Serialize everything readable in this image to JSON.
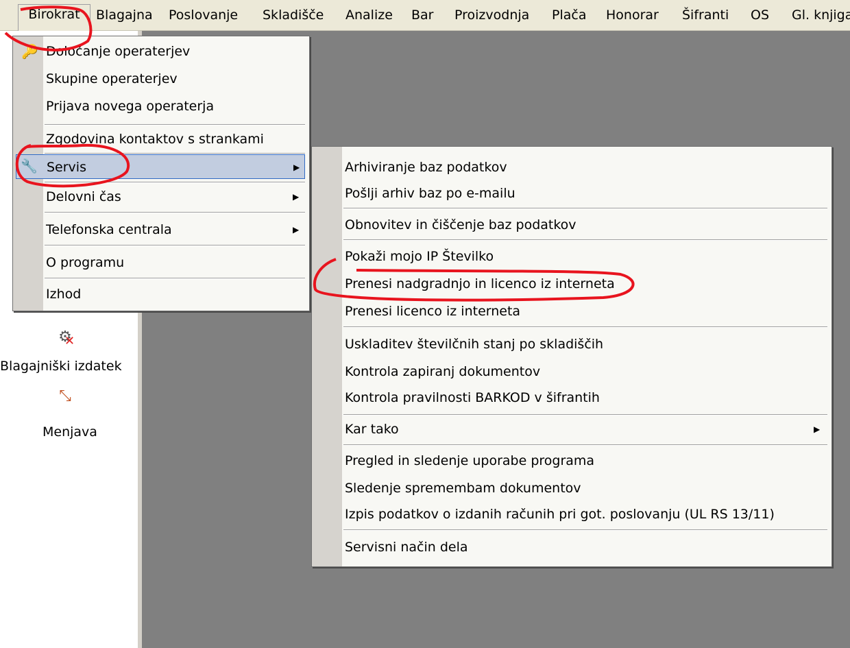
{
  "menubar": {
    "items": [
      {
        "label": "Birokrat"
      },
      {
        "label": "Blagajna"
      },
      {
        "label": "Poslovanje"
      },
      {
        "label": "Skladišče"
      },
      {
        "label": "Analize"
      },
      {
        "label": "Bar"
      },
      {
        "label": "Proizvodnja"
      },
      {
        "label": "Plača"
      },
      {
        "label": "Honorar"
      },
      {
        "label": "Šifranti"
      },
      {
        "label": "OS"
      },
      {
        "label": "Gl. knjiga"
      }
    ]
  },
  "leftpane": {
    "items": [
      {
        "label": "Blagajniški izdatek",
        "icon": "cash-out-icon"
      },
      {
        "label": "Menjava",
        "icon": "exchange-icon"
      }
    ]
  },
  "birokrat_menu": {
    "items": [
      {
        "label": "Določanje operaterjev"
      },
      {
        "label": "Skupine operaterjev"
      },
      {
        "label": "Prijava novega operaterja"
      },
      {
        "label": "Zgodovina kontaktov s strankami"
      },
      {
        "label": "Servis"
      },
      {
        "label": "Delovni čas"
      },
      {
        "label": "Telefonska centrala"
      },
      {
        "label": "O programu"
      },
      {
        "label": "Izhod"
      }
    ]
  },
  "servis_menu": {
    "items": [
      {
        "label": "Arhiviranje baz podatkov"
      },
      {
        "label": "Pošlji arhiv baz po e-mailu"
      },
      {
        "label": "Obnovitev in čiščenje baz podatkov"
      },
      {
        "label": "Pokaži mojo IP Številko"
      },
      {
        "label": "Prenesi nadgradnjo in licenco iz interneta"
      },
      {
        "label": "Prenesi licenco iz interneta"
      },
      {
        "label": "Uskladitev številčnih stanj po skladiščih"
      },
      {
        "label": "Kontrola zapiranj dokumentov"
      },
      {
        "label": "Kontrola pravilnosti BARKOD v šifrantih"
      },
      {
        "label": "Kar tako"
      },
      {
        "label": "Pregled in sledenje uporabe programa"
      },
      {
        "label": "Sledenje spremembam dokumentov"
      },
      {
        "label": "Izpis podatkov o izdanih računih pri got. poslovanju (UL RS 13/11)"
      },
      {
        "label": "Servisni način dela"
      }
    ]
  },
  "colors": {
    "desktop": "#808080",
    "menu_bg": "#f8f8f4",
    "highlight": "#c2cde0",
    "annotation": "#e8141e"
  }
}
